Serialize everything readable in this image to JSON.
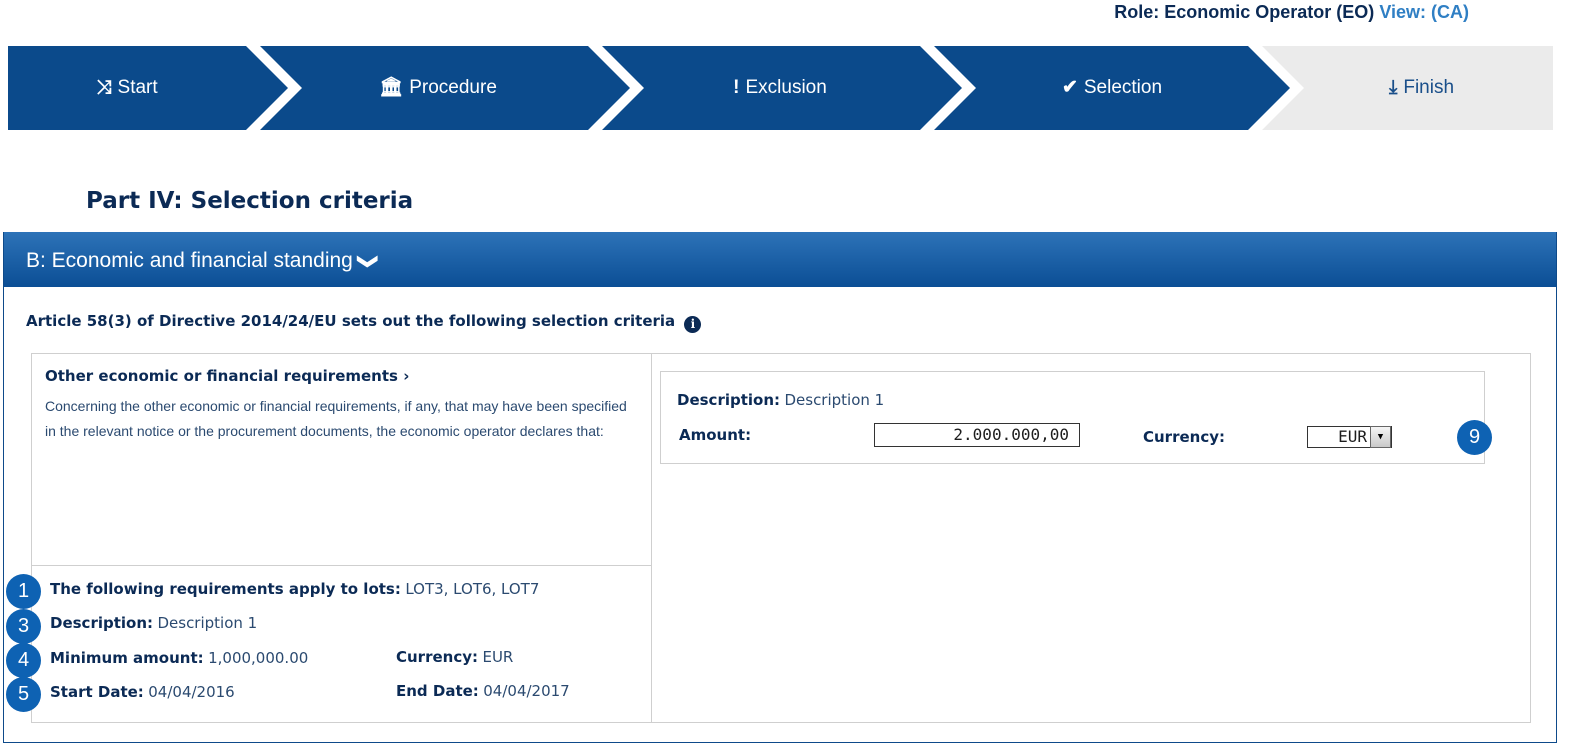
{
  "header": {
    "role_label": "Role: Economic Operator (EO)",
    "view_label": "View: (CA)"
  },
  "steps": [
    {
      "icon": "shuffle-icon",
      "glyph": "⤨",
      "label": "Start"
    },
    {
      "icon": "institution-icon",
      "glyph": "🏛",
      "label": "Procedure"
    },
    {
      "icon": "exclamation-icon",
      "glyph": "!",
      "label": "Exclusion"
    },
    {
      "icon": "check-circle-icon",
      "glyph": "✔",
      "label": "Selection"
    },
    {
      "icon": "download-icon",
      "glyph": "⤓",
      "label": "Finish"
    }
  ],
  "page_title": "Part IV: Selection criteria",
  "section": {
    "header": "B: Economic and financial standing",
    "chevron": "❯",
    "article": "Article 58(3) of Directive 2014/24/EU sets out the following selection criteria",
    "info_glyph": "i"
  },
  "criterion": {
    "title": "Other economic or financial requirements",
    "title_chevron": "›",
    "description": "Concerning the other economic or financial requirements, if any, that may have been specified in the relevant notice or the procurement documents, the economic operator declares that:",
    "lots_label": "The following requirements apply to lots:",
    "lots_value": "LOT3, LOT6, LOT7",
    "description_label": "Description:",
    "description_value": "Description 1",
    "min_amount_label": "Minimum amount:",
    "min_amount_value": "1,000,000.00",
    "currency_label": "Currency:",
    "currency_value": "EUR",
    "start_label": "Start Date:",
    "start_value": "04/04/2016",
    "end_label": "End Date:",
    "end_value": "04/04/2017"
  },
  "response": {
    "description_label": "Description:",
    "description_value": "Description 1",
    "amount_label": "Amount:",
    "amount_value": "2.000.000,00",
    "currency_label": "Currency:",
    "currency_value": "EUR",
    "select_arrow": "▼"
  },
  "badges": [
    "1",
    "3",
    "4",
    "5",
    "9"
  ],
  "colors": {
    "step_active": "#0b4a8b",
    "step_inactive": "#ebebeb",
    "badge": "#0e62b3",
    "heading": "#0b2a55"
  }
}
